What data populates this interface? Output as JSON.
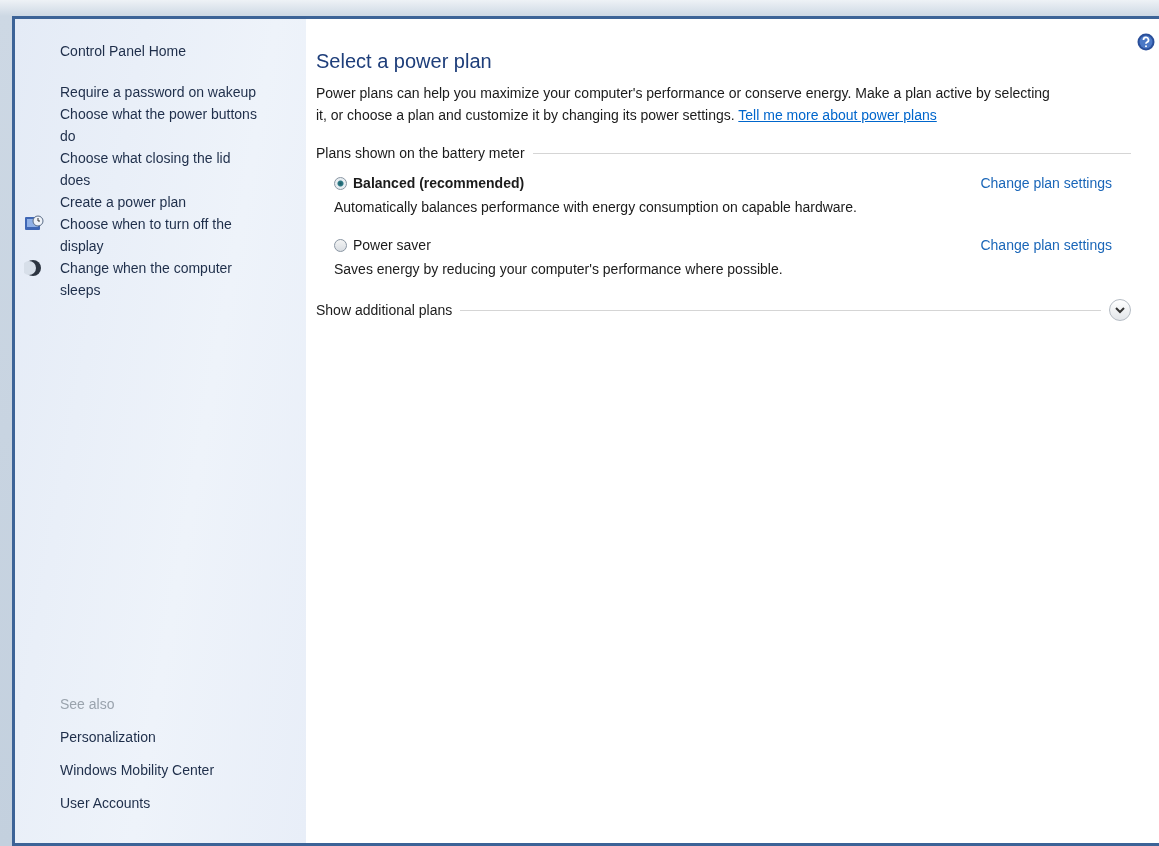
{
  "sidebar": {
    "home": "Control Panel Home",
    "links": [
      {
        "label": "Require a password on wakeup",
        "kind": "plain"
      },
      {
        "label": "Choose what the power buttons do",
        "kind": "plain"
      },
      {
        "label": "Choose what closing the lid does",
        "kind": "plain"
      },
      {
        "label": "Create a power plan",
        "kind": "plain"
      },
      {
        "label": "Choose when to turn off the display",
        "kind": "display"
      },
      {
        "label": "Change when the computer sleeps",
        "kind": "sleep"
      }
    ],
    "see_also": {
      "heading": "See also",
      "links": [
        "Personalization",
        "Windows Mobility Center",
        "User Accounts"
      ]
    }
  },
  "main": {
    "title": "Select a power plan",
    "description": "Power plans can help you maximize your computer's performance or conserve energy. Make a plan active by selecting it, or choose a plan and customize it by changing its power settings.",
    "description_link": "Tell me more about power plans",
    "group_heading": "Plans shown on the battery meter",
    "plans": [
      {
        "name": "Balanced (recommended)",
        "selected": true,
        "description": "Automatically balances performance with energy consumption on capable hardware.",
        "settings_link": "Change plan settings"
      },
      {
        "name": "Power saver",
        "selected": false,
        "description": "Saves energy by reducing your computer's performance where possible.",
        "settings_link": "Change plan settings"
      }
    ],
    "additional": {
      "label": "Show additional plans",
      "expanded": false
    }
  }
}
